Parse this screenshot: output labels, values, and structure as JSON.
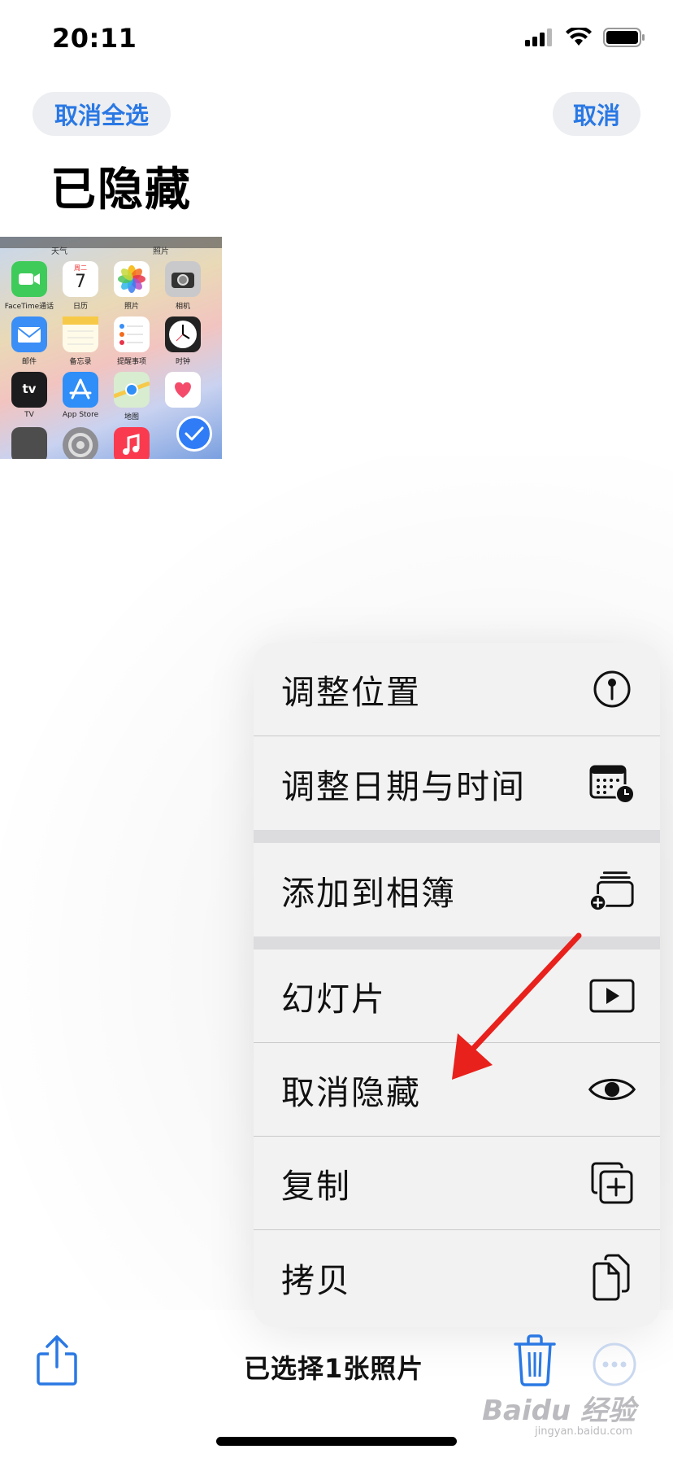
{
  "status_bar": {
    "time": "20:11"
  },
  "nav": {
    "deselect_all": "取消全选",
    "cancel": "取消"
  },
  "page": {
    "title": "已隐藏"
  },
  "thumbnail": {
    "top_labels": [
      "天气",
      "照片"
    ],
    "apps": [
      {
        "label": "FaceTime通话",
        "color": "#3ecb5a",
        "icon": "facetime-icon"
      },
      {
        "label": "日历",
        "color": "#ffffff",
        "icon": "calendar-icon",
        "day": "周二",
        "date": "7"
      },
      {
        "label": "照片",
        "color": "#ffffff",
        "icon": "photos-icon"
      },
      {
        "label": "相机",
        "color": "#c9c9cc",
        "icon": "camera-icon"
      },
      {
        "label": "邮件",
        "color": "#3a8ef6",
        "icon": "mail-icon"
      },
      {
        "label": "备忘录",
        "color": "#fffbe8",
        "icon": "notes-icon"
      },
      {
        "label": "提醒事项",
        "color": "#ffffff",
        "icon": "reminders-icon"
      },
      {
        "label": "时钟",
        "color": "#222222",
        "icon": "clock-icon"
      },
      {
        "label": "TV",
        "color": "#1c1c1e",
        "icon": "tv-icon",
        "text": "tv"
      },
      {
        "label": "App Store",
        "color": "#2f8ef7",
        "icon": "app-store-icon"
      },
      {
        "label": "地图",
        "color": "#d8ecd0",
        "icon": "maps-icon"
      },
      {
        "label": "",
        "color": "#ffffff",
        "icon": "health-icon"
      },
      {
        "label": "",
        "color": "#4d4d4d",
        "icon": "wallet-icon"
      },
      {
        "label": "",
        "color": "#8e8e93",
        "icon": "settings-icon"
      },
      {
        "label": "",
        "color": "#fa3a4f",
        "icon": "music-icon"
      },
      {
        "label": "",
        "color": "transparent",
        "icon": "none"
      }
    ],
    "selected": true
  },
  "menu": {
    "items": [
      {
        "label": "调整位置",
        "icon": "location-pin-icon"
      },
      {
        "label": "调整日期与时间",
        "icon": "calendar-clock-icon"
      },
      {
        "label": "添加到相簿",
        "icon": "add-to-album-icon"
      },
      {
        "label": "幻灯片",
        "icon": "slideshow-icon"
      },
      {
        "label": "取消隐藏",
        "icon": "eye-icon"
      },
      {
        "label": "复制",
        "icon": "duplicate-icon"
      },
      {
        "label": "拷贝",
        "icon": "copy-icon"
      }
    ]
  },
  "toolbar": {
    "selection_count": "已选择1张照片"
  },
  "watermark": {
    "text": "Baidu 经验",
    "sub": "jingyan.baidu.com"
  },
  "colors": {
    "accent": "#2a78e4",
    "arrow": "#e8211c"
  }
}
